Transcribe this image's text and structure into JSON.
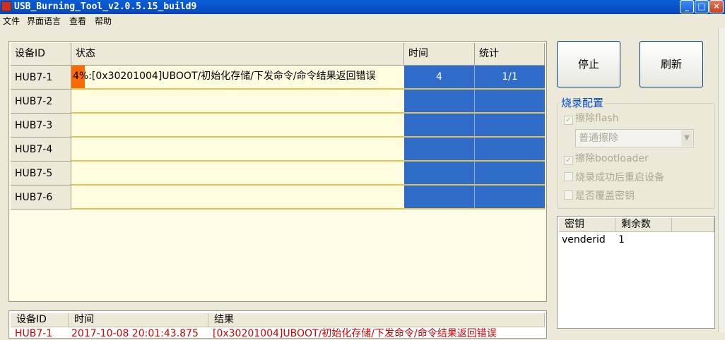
{
  "window": {
    "title": "USB_Burning_Tool_v2.0.5.15_build9"
  },
  "menu": [
    "文件",
    "界面语言",
    "查看",
    "帮助"
  ],
  "device_table": {
    "headers": [
      "设备ID",
      "状态",
      "时间",
      "统计"
    ],
    "rows": [
      {
        "id": "HUB7-1",
        "status": "4%:[0x30201004]UBOOT/初始化存储/下发命令/命令结果返回错误",
        "progress_percent": 4,
        "time": "4",
        "stat": "1/1"
      },
      {
        "id": "HUB7-2",
        "status": "",
        "time": "",
        "stat": ""
      },
      {
        "id": "HUB7-3",
        "status": "",
        "time": "",
        "stat": ""
      },
      {
        "id": "HUB7-4",
        "status": "",
        "time": "",
        "stat": ""
      },
      {
        "id": "HUB7-5",
        "status": "",
        "time": "",
        "stat": ""
      },
      {
        "id": "HUB7-6",
        "status": "",
        "time": "",
        "stat": ""
      }
    ]
  },
  "buttons": {
    "stop": "停止",
    "refresh": "刷新"
  },
  "burn_config": {
    "title": "烧录配置",
    "erase_flash": {
      "label": "擦除flash",
      "checked": true
    },
    "erase_mode": "普通擦除",
    "erase_bootloader": {
      "label": "擦除bootloader",
      "checked": true
    },
    "reboot_after": {
      "label": "烧录成功后重启设备",
      "checked": false
    },
    "overwrite_key": {
      "label": "是否覆盖密钥",
      "checked": false
    }
  },
  "key_table": {
    "headers": [
      "密钥",
      "剩余数"
    ],
    "rows": [
      {
        "key": "venderid",
        "remaining": "1"
      }
    ]
  },
  "log_table": {
    "headers": [
      "设备ID",
      "时间",
      "结果"
    ],
    "rows": [
      {
        "id": "HUB7-1",
        "time": "2017-10-08 20:01:43.875",
        "result": "[0x30201004]UBOOT/初始化存储/下发命令/命令结果返回错误"
      }
    ]
  },
  "colors": {
    "progress": "#ff6a00",
    "time_cell": "#2f6bc8",
    "row_accent": "#e6c24a",
    "error_text": "#d00000"
  }
}
